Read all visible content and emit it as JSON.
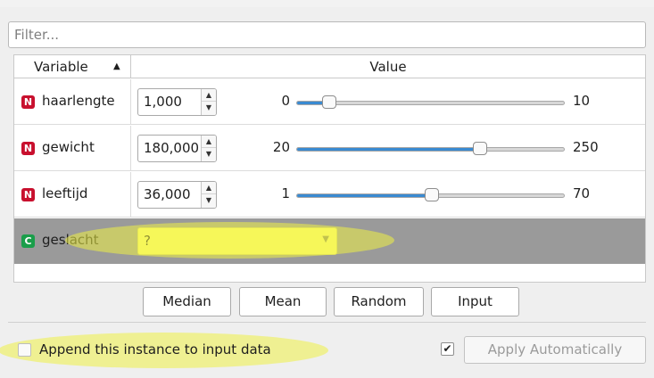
{
  "filter": {
    "placeholder": "Filter..."
  },
  "table": {
    "headers": {
      "variable": "Variable",
      "value": "Value",
      "sort_indicator": "▲"
    },
    "rows": [
      {
        "type": "N",
        "name": "haarlengte",
        "value": "1,000",
        "min": "0",
        "max": "10",
        "fraction": 0.1
      },
      {
        "type": "N",
        "name": "gewicht",
        "value": "180,000",
        "min": "20",
        "max": "250",
        "fraction": 0.696
      },
      {
        "type": "N",
        "name": "leeftijd",
        "value": "36,000",
        "min": "1",
        "max": "70",
        "fraction": 0.507
      },
      {
        "type": "C",
        "name": "geslacht",
        "value": "?"
      }
    ]
  },
  "buttons": {
    "median": "Median",
    "mean": "Mean",
    "random": "Random",
    "input": "Input"
  },
  "append": {
    "label": "Append this instance to input data",
    "checked": false
  },
  "apply": {
    "label": "Apply Automatically",
    "checked": true,
    "check_glyph": "✔"
  },
  "colors": {
    "numeric_badge": "#c8102e",
    "categorical_badge": "#1a9e4a",
    "slider_fill": "#3a8ad1",
    "selected_row": "#9a9a9a",
    "highlight": "#eef046"
  }
}
